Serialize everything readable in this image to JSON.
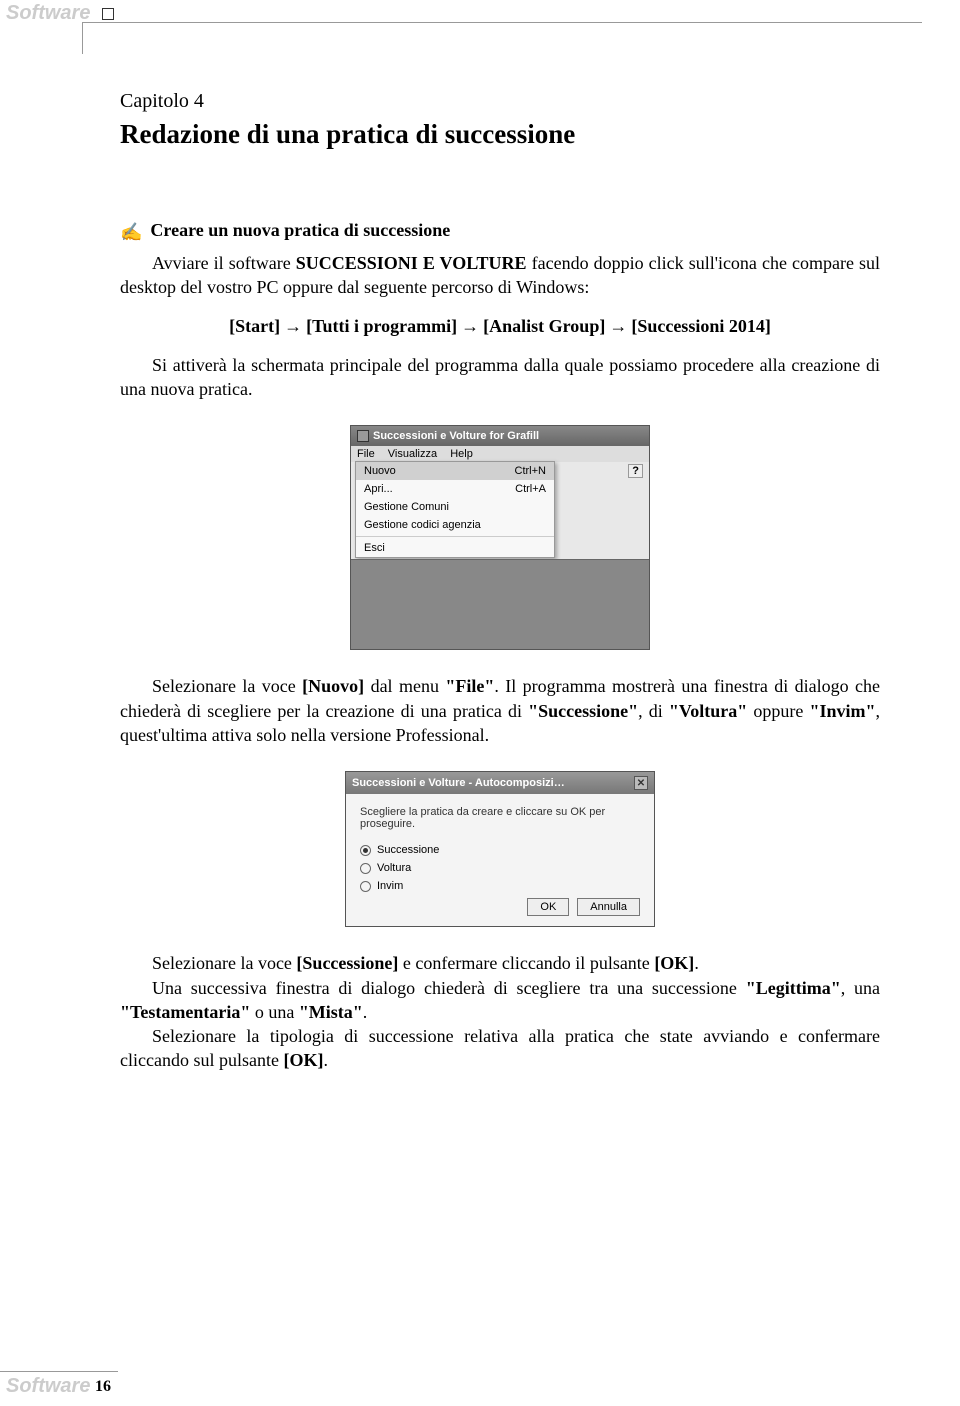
{
  "header": {
    "tab_label": "Software"
  },
  "chapter": "Capitolo 4",
  "title": "Redazione di una pratica di successione",
  "section1": {
    "heading": "Creare un nuova pratica di successione",
    "p1a": "Avviare il software ",
    "p1b": "SUCCESSIONI E VOLTURE",
    "p1c": " facendo doppio click sull'icona che compare sul desktop del vostro PC oppure dal seguente percorso di Windows:",
    "path": {
      "s1": "[Start]",
      "s2": "[Tutti i programmi]",
      "s3": "[Analist Group]",
      "s4": "[Successioni 2014]"
    },
    "p2": "Si attiverà la schermata principale del programma dalla quale possiamo procedere alla creazione di una nuova pratica."
  },
  "win1": {
    "title": "Successioni e Volture for Grafill",
    "menubar": [
      "File",
      "Visualizza",
      "Help"
    ],
    "menu": [
      {
        "label": "Nuovo",
        "shortcut": "Ctrl+N",
        "sel": true
      },
      {
        "label": "Apri...",
        "shortcut": "Ctrl+A"
      },
      {
        "label": "Gestione Comuni",
        "shortcut": ""
      },
      {
        "label": "Gestione codici agenzia",
        "shortcut": ""
      },
      {
        "sep": true
      },
      {
        "label": "Esci",
        "shortcut": ""
      }
    ]
  },
  "para3a": "Selezionare la voce ",
  "para3b": "[Nuovo]",
  "para3c": " dal menu ",
  "para3d": "\"File\"",
  "para3e": ". Il programma mostrerà una finestra di dialogo che chiederà di scegliere per la creazione di una pratica di ",
  "para3f": "\"Successione\"",
  "para3g": ", di ",
  "para3h": "\"Voltura\"",
  "para3i": " oppure ",
  "para3j": "\"Invim\"",
  "para3k": ", quest'ultima attiva solo nella versione Professional.",
  "win2": {
    "title": "Successioni e Volture - Autocomposizi…",
    "msg": "Scegliere la pratica da creare e cliccare su OK per proseguire.",
    "options": [
      {
        "label": "Successione",
        "sel": true
      },
      {
        "label": "Voltura",
        "sel": false
      },
      {
        "label": "Invim",
        "sel": false
      }
    ],
    "ok": "OK",
    "cancel": "Annulla"
  },
  "para4a": "Selezionare la voce ",
  "para4b": "[Successione]",
  "para4c": " e confermare cliccando il pulsante ",
  "para4d": "[OK]",
  "para4e": ".",
  "para5a": "Una successiva finestra di dialogo chiederà di scegliere tra una successione ",
  "para5b": "\"Legittima\"",
  "para5c": ", una ",
  "para5d": "\"Testamentaria\"",
  "para5e": " o una ",
  "para5f": "\"Mista\"",
  "para5g": ".",
  "para6a": "Selezionare la tipologia di successione relativa alla pratica che state avviando e confermare cliccando sul pulsante ",
  "para6b": "[OK]",
  "para6c": ".",
  "footer": {
    "tab_label": "Software",
    "page": "16"
  }
}
